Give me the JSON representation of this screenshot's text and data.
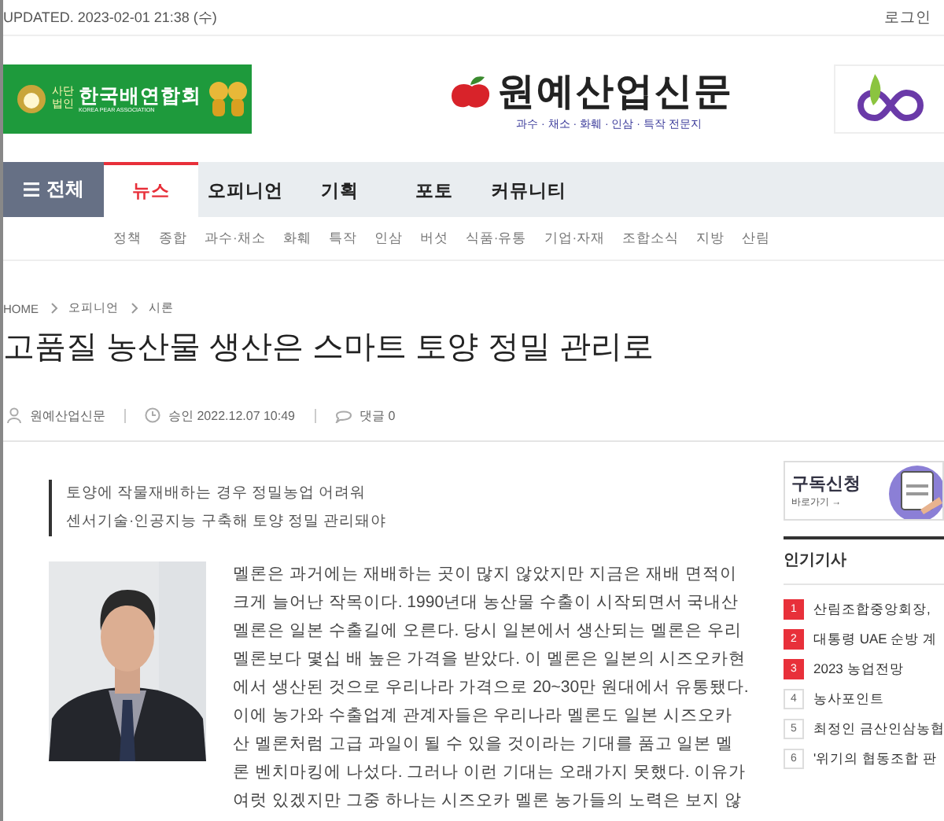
{
  "top_bar": {
    "updated": "UPDATED. 2023-02-01 21:38 (수)",
    "login": "로그인"
  },
  "left_banner": {
    "prefix_top": "사단",
    "prefix_bottom": "법인",
    "name": "한국배연합회",
    "english": "KOREA PEAR ASSOCIATION"
  },
  "masthead": {
    "name": "원예산업신문",
    "tagline": "과수 · 채소 · 화훼 · 인삼 · 특작 전문지"
  },
  "nav": {
    "all_label": "전체",
    "items": [
      {
        "label": "뉴스",
        "selected": true
      },
      {
        "label": "오피니언",
        "selected": false
      },
      {
        "label": "기획",
        "selected": false
      },
      {
        "label": "포토",
        "selected": false
      },
      {
        "label": "커뮤니티",
        "selected": false
      }
    ]
  },
  "sub_nav": [
    "정책",
    "종합",
    "과수·채소",
    "화훼",
    "특작",
    "인삼",
    "버섯",
    "식품·유통",
    "기업·자재",
    "조합소식",
    "지방",
    "산림"
  ],
  "breadcrumb": [
    "HOME",
    "오피니언",
    "시론"
  ],
  "article": {
    "title": "고품질 농산물 생산은 스마트 토양 정밀 관리로",
    "author": "원예산업신문",
    "approved": "승인 2022.12.07 10:49",
    "comments": "댓글 0",
    "summary": [
      "토양에 작물재배하는 경우 정밀농업 어려워",
      "센서기술·인공지능 구축해 토양 정밀 관리돼야"
    ],
    "photo": {
      "kind": "picture"
    },
    "body_lines": [
      "멜론은 과거에는 재배하는 곳이 많지 않았지만 지금은 재배 면적이",
      "크게 늘어난 작목이다. 1990년대 농산물 수출이 시작되면서 국내산",
      "멜론은 일본 수출길에 오른다. 당시 일본에서 생산되는 멜론은 우리",
      "멜론보다 몇십 배 높은 가격을 받았다. 이 멜론은 일본의 시즈오카현",
      "에서 생산된 것으로 우리나라 가격으로 20~30만 원대에서 유통됐다.",
      "이에 농가와 수출업계 관계자들은 우리나라 멜론도 일본 시즈오카",
      "산 멜론처럼 고급 과일이 될 수 있을 것이라는 기대를 품고 일본 멜",
      "론 벤치마킹에 나섰다. 그러나 이런 기대는 오래가지 못했다. 이유가",
      "여럿 있겠지만 그중 하나는 시즈오카 멜론 농가들의 노력은 보지 않"
    ]
  },
  "subscribe": {
    "title": "구독신청",
    "link": "바로가기 →"
  },
  "popular": {
    "title": "인기기사",
    "items": [
      {
        "rank": "1",
        "highlighted": true,
        "title": "산림조합중앙회장,"
      },
      {
        "rank": "2",
        "highlighted": true,
        "title": "대통령 UAE 순방 계"
      },
      {
        "rank": "3",
        "highlighted": true,
        "title": "2023 농업전망"
      },
      {
        "rank": "4",
        "highlighted": false,
        "title": "농사포인트"
      },
      {
        "rank": "5",
        "highlighted": false,
        "title": "최정인 금산인삼농협"
      },
      {
        "rank": "6",
        "highlighted": false,
        "title": "'위기의 협동조합 판"
      }
    ]
  }
}
